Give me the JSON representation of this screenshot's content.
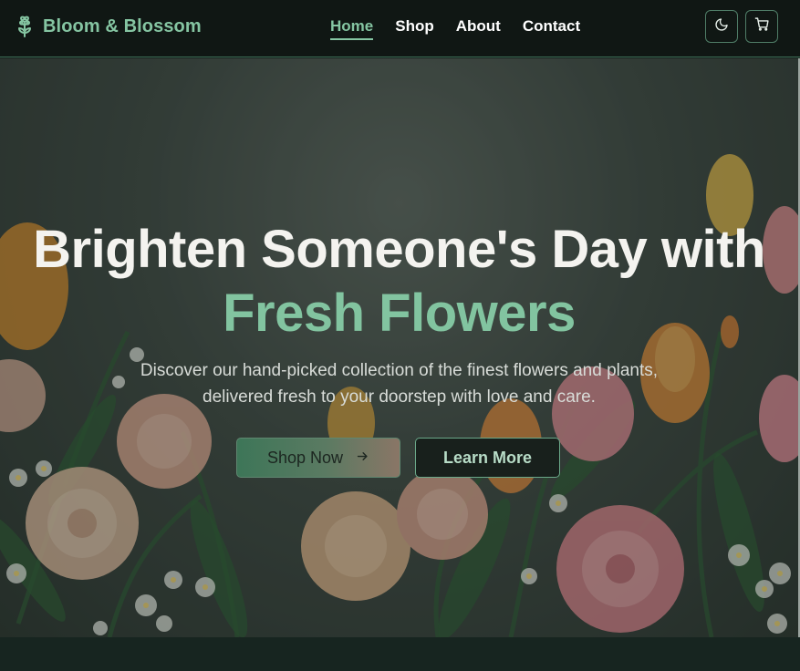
{
  "header": {
    "brand": "Bloom & Blossom",
    "brand_icon": "flower-icon",
    "nav": [
      {
        "label": "Home",
        "active": true
      },
      {
        "label": "Shop",
        "active": false
      },
      {
        "label": "About",
        "active": false
      },
      {
        "label": "Contact",
        "active": false
      }
    ],
    "theme_icon": "moon-icon",
    "cart_icon": "cart-icon"
  },
  "hero": {
    "title_line1": "Brighten Someone's Day with",
    "title_line2": "Fresh Flowers",
    "subtitle": "Discover our hand-picked collection of the finest flowers and plants, delivered fresh to your doorstep with love and care.",
    "primary_button": "Shop Now",
    "primary_button_icon": "arrow-right-icon",
    "secondary_button": "Learn More"
  },
  "colors": {
    "accent": "#85c5a2",
    "header_bg": "#101714",
    "page_bg": "#141f1b"
  }
}
